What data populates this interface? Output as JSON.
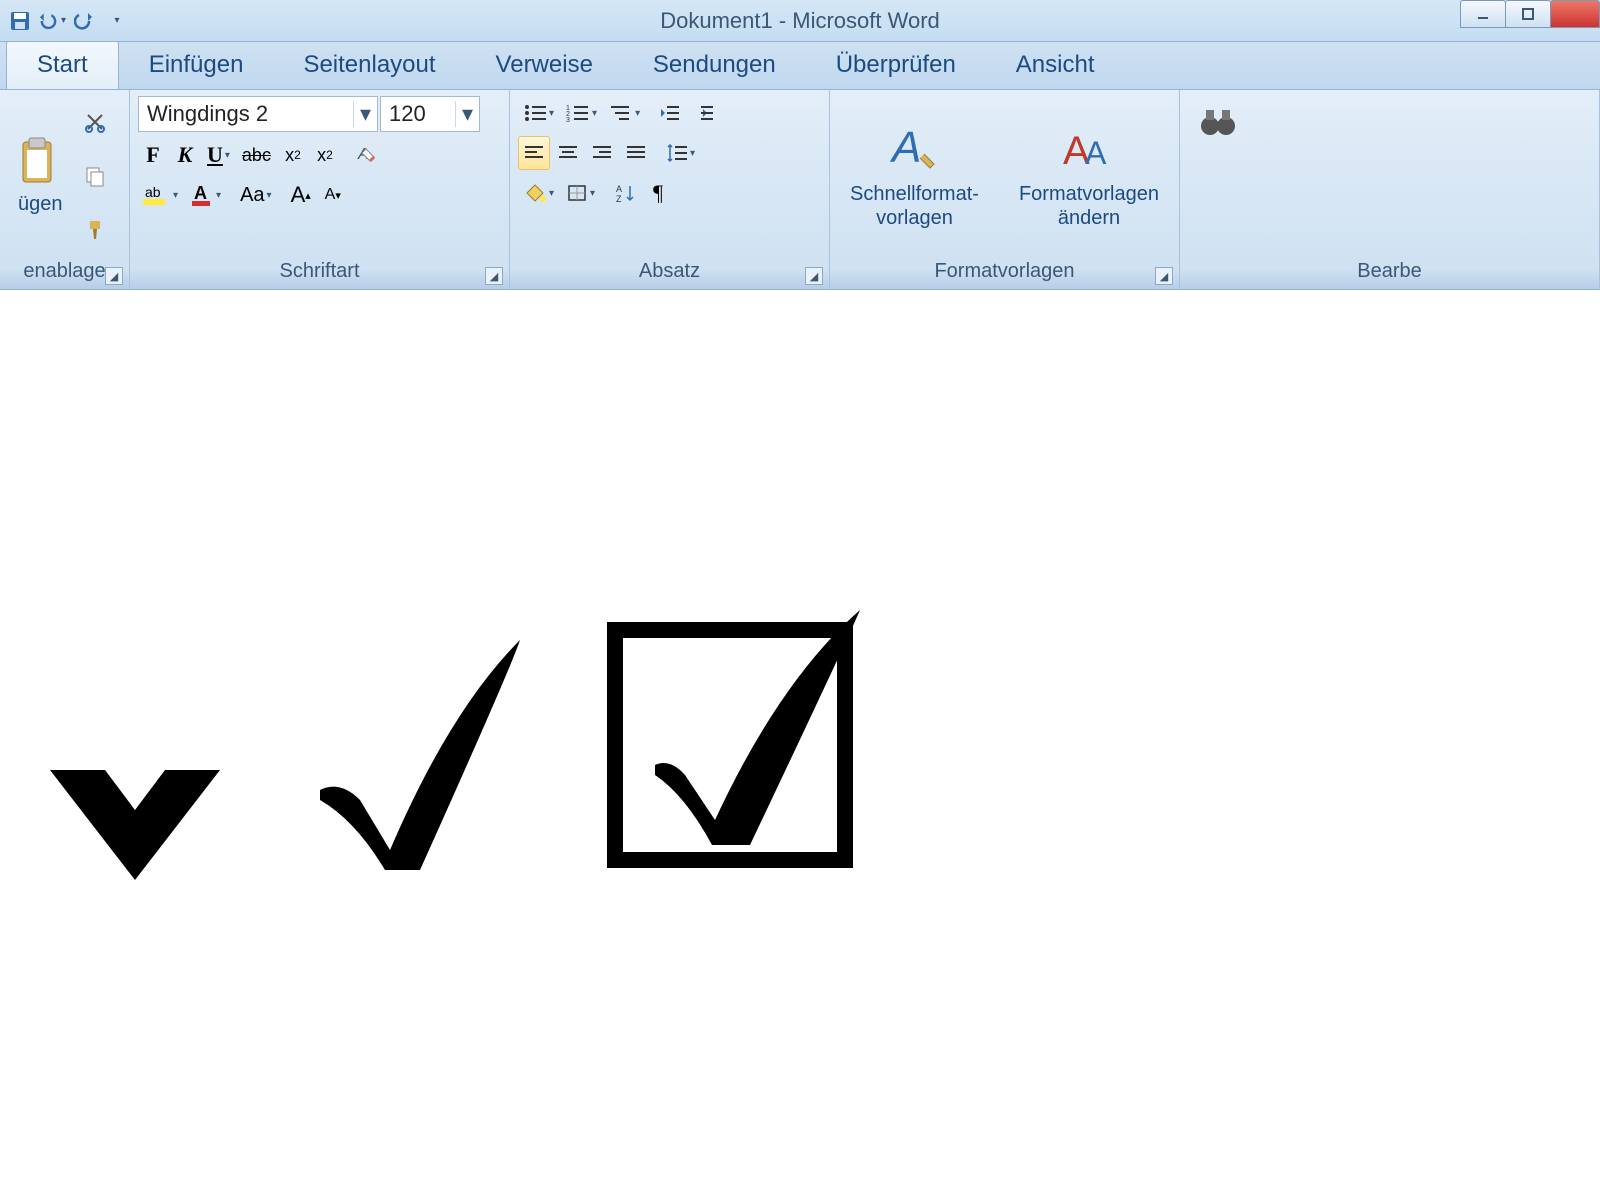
{
  "title": "Dokument1 - Microsoft Word",
  "qat": {
    "undo": "↶",
    "redo": "↷"
  },
  "tabs": [
    "Start",
    "Einfügen",
    "Seitenlayout",
    "Verweise",
    "Sendungen",
    "Überprüfen",
    "Ansicht"
  ],
  "active_tab": "Start",
  "clipboard": {
    "label": "enablage",
    "paste_caption": "ügen"
  },
  "font": {
    "label": "Schriftart",
    "family": "Wingdings 2",
    "size": "120",
    "bold": "F",
    "italic": "K",
    "underline": "U",
    "strike": "abc",
    "sub": "x",
    "sup": "x",
    "casebtn": "Aa",
    "grow": "A",
    "shrink": "A"
  },
  "para": {
    "label": "Absatz"
  },
  "styles": {
    "label": "Formatvorlagen",
    "quick": "Schnellformat-\nvorlagen",
    "change": "Formatvorlagen\nändern"
  },
  "editing": {
    "label": "Bearbe"
  },
  "doc": {
    "char1": "heavy-check",
    "char2": "check",
    "char3": "boxed-check"
  }
}
